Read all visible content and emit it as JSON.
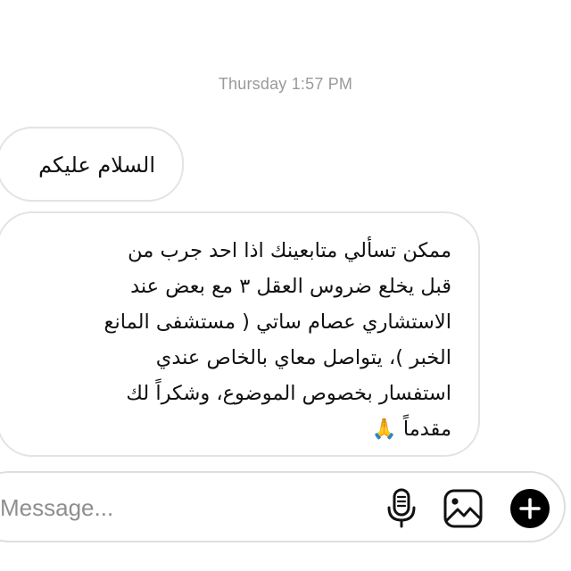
{
  "chat": {
    "timestamp": "Thursday 1:57 PM",
    "messages": [
      {
        "lines": [
          "السلام عليكم"
        ]
      },
      {
        "lines": [
          "ممكن تسألي متابعينك اذا احد جرب من",
          "قبل يخلع ضروس العقل ٣ مع بعض عند",
          "الاستشاري عصام ساتي ( مستشفى المانع",
          "الخبر )، يتواصل معاي بالخاص عندي",
          "استفسار بخصوص الموضوع، وشكراً لك",
          "مقدماً 🙏"
        ]
      }
    ]
  },
  "composer": {
    "placeholder": "Message...",
    "icons": {
      "mic": "microphone-icon",
      "photo": "photo-gallery-icon",
      "plus": "plus-icon"
    }
  }
}
